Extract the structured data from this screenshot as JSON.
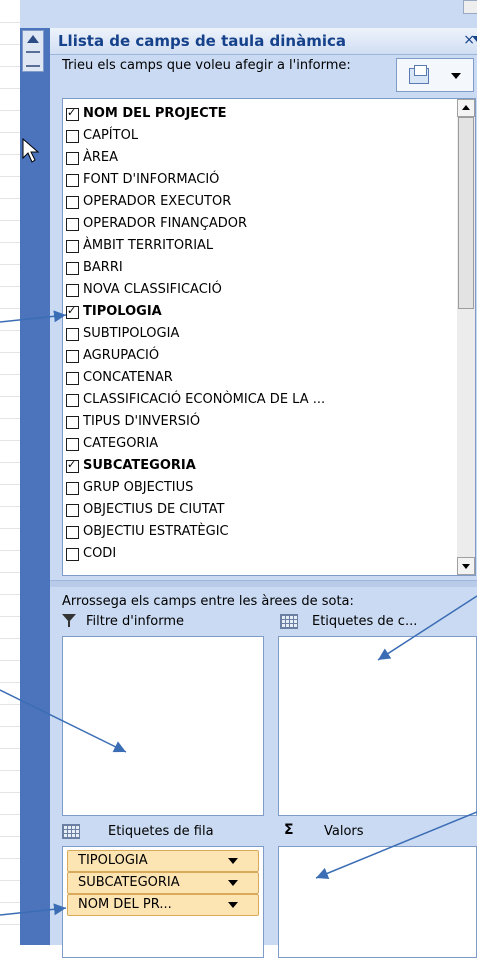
{
  "pane": {
    "title": "Llista de camps de taula dinàmica",
    "close_glyph": "×",
    "instruction": "Trieu els camps que voleu afegir a l'informe:"
  },
  "fields": [
    {
      "label": "NOM DEL PROJECTE",
      "checked": true
    },
    {
      "label": "CAPÍTOL",
      "checked": false
    },
    {
      "label": "ÀREA",
      "checked": false
    },
    {
      "label": "FONT D'INFORMACIÓ",
      "checked": false
    },
    {
      "label": "OPERADOR EXECUTOR",
      "checked": false
    },
    {
      "label": "OPERADOR FINANÇADOR",
      "checked": false
    },
    {
      "label": "ÀMBIT TERRITORIAL",
      "checked": false
    },
    {
      "label": "BARRI",
      "checked": false
    },
    {
      "label": "NOVA CLASSIFICACIÓ",
      "checked": false
    },
    {
      "label": "TIPOLOGIA",
      "checked": true
    },
    {
      "label": "SUBTIPOLOGIA",
      "checked": false
    },
    {
      "label": "AGRUPACIÓ",
      "checked": false
    },
    {
      "label": "CONCATENAR",
      "checked": false
    },
    {
      "label": "CLASSIFICACIÓ ECONÒMICA DE LA ...",
      "checked": false
    },
    {
      "label": "TIPUS D'INVERSIÓ",
      "checked": false
    },
    {
      "label": "CATEGORIA",
      "checked": false
    },
    {
      "label": "SUBCATEGORIA",
      "checked": true
    },
    {
      "label": "GRUP OBJECTIUS",
      "checked": false
    },
    {
      "label": "OBJECTIUS DE CIUTAT",
      "checked": false
    },
    {
      "label": "OBJECTIU ESTRATÈGIC",
      "checked": false
    },
    {
      "label": "CODI",
      "checked": false
    }
  ],
  "areas": {
    "hint": "Arrossega els camps entre les àrees de sota:",
    "report_filter": "Filtre d'informe",
    "column_labels": "Etiquetes de c...",
    "row_labels": "Etiquetes de fila",
    "values": "Valors",
    "row_chips": [
      "TIPOLOGIA",
      "SUBCATEGORIA",
      "NOM DEL PR..."
    ]
  },
  "colors": {
    "accent": "#15428b",
    "pane_bg": "#c9daf2",
    "arrow": "#3b6db5",
    "chip": "#fde4b3"
  }
}
